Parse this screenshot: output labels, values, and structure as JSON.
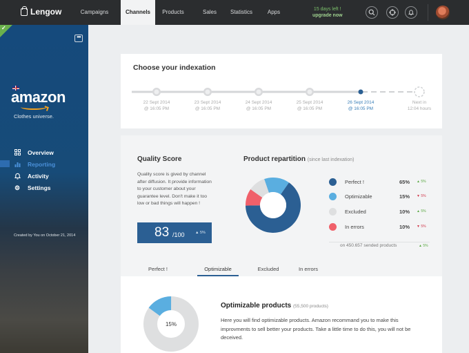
{
  "topbar": {
    "logo": "Lengow",
    "nav": [
      {
        "label": "Campaigns",
        "active": false
      },
      {
        "label": "Channels",
        "active": true
      },
      {
        "label": "Products",
        "active": false
      },
      {
        "label": "Sales",
        "active": false
      },
      {
        "label": "Statistics",
        "active": false
      },
      {
        "label": "Apps",
        "active": false
      }
    ],
    "trial_line1": "15 days left !",
    "trial_line2": "upgrade now",
    "icons": [
      "search-icon",
      "target-icon",
      "bell-icon"
    ]
  },
  "sidebar": {
    "more": "•••",
    "channel_name": "amazon",
    "tagline": "Clothes universe.",
    "menu": [
      {
        "label": "Overview",
        "icon": "grid-icon",
        "active": false
      },
      {
        "label": "Reporting",
        "icon": "chart-icon",
        "active": true
      },
      {
        "label": "Activity",
        "icon": "bell-icon",
        "active": false
      },
      {
        "label": "Settings",
        "icon": "gear-icon",
        "active": false
      }
    ],
    "created": "Created by You on October 21, 2014"
  },
  "indexation": {
    "title": "Choose your indexation",
    "steps": [
      {
        "date": "22 Sept 2014",
        "time": "@ 16:05 PM",
        "state": "past"
      },
      {
        "date": "23 Sept 2014",
        "time": "@ 16:05 PM",
        "state": "past"
      },
      {
        "date": "24 Sept 2014",
        "time": "@ 16:05 PM",
        "state": "past"
      },
      {
        "date": "25 Sept 2014",
        "time": "@ 16:05 PM",
        "state": "past"
      },
      {
        "date": "26 Sept 2014",
        "time": "@ 16:05 PM",
        "state": "current"
      },
      {
        "date": "Next in",
        "time": "12:04 hours",
        "state": "next"
      }
    ]
  },
  "quality": {
    "title": "Quality Score",
    "description": "Quality score is gived by channel after diffusion. It provide information to your customer about your guarantee level. Don't make it too low or bad things will happen !",
    "score": "83",
    "max": "/100",
    "delta": "▲ 5%"
  },
  "repartition": {
    "title": "Product repartition",
    "subtitle": "(since last indexation)",
    "items": [
      {
        "label": "Perfect !",
        "pct": "65%",
        "delta": "▲ 5%",
        "dir": "up",
        "color": "#2b5f93"
      },
      {
        "label": "Optimizable",
        "pct": "15%",
        "delta": "▼ 5%",
        "dir": "down",
        "color": "#5aaee0"
      },
      {
        "label": "Excluded",
        "pct": "10%",
        "delta": "▲ 5%",
        "dir": "up",
        "color": "#dedfe0"
      },
      {
        "label": "In errors",
        "pct": "10%",
        "delta": "▼ 5%",
        "dir": "down",
        "color": "#f0606a"
      }
    ],
    "footer": "on 450.657 sended products",
    "footer_delta": "▲ 5%"
  },
  "chart_data": {
    "type": "pie",
    "categories": [
      "Perfect !",
      "Optimizable",
      "Excluded",
      "In errors"
    ],
    "values": [
      65,
      15,
      10,
      10
    ],
    "colors": [
      "#2b5f93",
      "#5aaee0",
      "#dedfe0",
      "#f0606a"
    ],
    "title": ""
  },
  "tabs": [
    {
      "label": "Perfect !",
      "active": false
    },
    {
      "label": "Optimizable",
      "active": true
    },
    {
      "label": "Excluded",
      "active": false
    },
    {
      "label": "In errors",
      "active": false
    }
  ],
  "optimizable": {
    "title": "Optimizable products",
    "count": "(55,500 products)",
    "description": "Here you will find optimizable products. Amazon recommand you to make this improvments to sell better your products. Take a little time to do this, you will not be deceived.",
    "pct_label": "15%",
    "pct_value": 15
  }
}
